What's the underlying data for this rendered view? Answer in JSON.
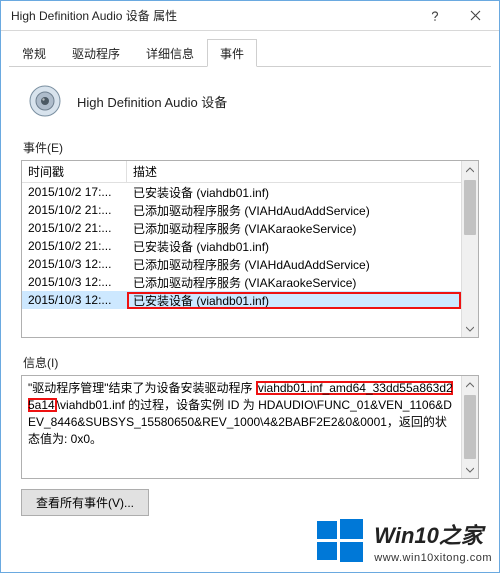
{
  "titlebar": {
    "title": "High Definition Audio 设备 属性"
  },
  "tabs": [
    {
      "label": "常规"
    },
    {
      "label": "驱动程序"
    },
    {
      "label": "详细信息"
    },
    {
      "label": "事件"
    }
  ],
  "header": {
    "device_name": "High Definition Audio 设备"
  },
  "events": {
    "label": "事件(E)",
    "columns": {
      "time": "时间戳",
      "desc": "描述"
    },
    "rows": [
      {
        "time": "2015/10/2 17:...",
        "desc": "已安装设备 (viahdb01.inf)"
      },
      {
        "time": "2015/10/2 21:...",
        "desc": "已添加驱动程序服务 (VIAHdAudAddService)"
      },
      {
        "time": "2015/10/2 21:...",
        "desc": "已添加驱动程序服务 (VIAKaraokeService)"
      },
      {
        "time": "2015/10/2 21:...",
        "desc": "已安装设备 (viahdb01.inf)"
      },
      {
        "time": "2015/10/3 12:...",
        "desc": "已添加驱动程序服务 (VIAHdAudAddService)"
      },
      {
        "time": "2015/10/3 12:...",
        "desc": "已添加驱动程序服务 (VIAKaraokeService)"
      },
      {
        "time": "2015/10/3 12:...",
        "desc": "已安装设备 (viahdb01.inf)"
      }
    ]
  },
  "info": {
    "label": "信息(I)",
    "line1_pre": "\"驱动程序管理\"结束了为设备安装驱动程序 ",
    "highlight": "viahdb01.inf_amd64_33dd55a863d25a14",
    "line1_post": "\\viahdb01.inf 的过程，设备实例 ID 为 HDAUDIO\\FUNC_01&VEN_1106&DEV_8446&SUBSYS_15580650&REV_1000\\4&2BABF2E2&0&0001，返回的状态值为: 0x0。"
  },
  "buttons": {
    "view_all": "查看所有事件(V)..."
  },
  "watermark": {
    "main": "Win10之家",
    "sub": "www.win10xitong.com"
  },
  "icons": {
    "help": "help-icon",
    "close": "close-icon",
    "speaker": "speaker-icon",
    "chev_up": "chevron-up-icon",
    "chev_down": "chevron-down-icon"
  }
}
